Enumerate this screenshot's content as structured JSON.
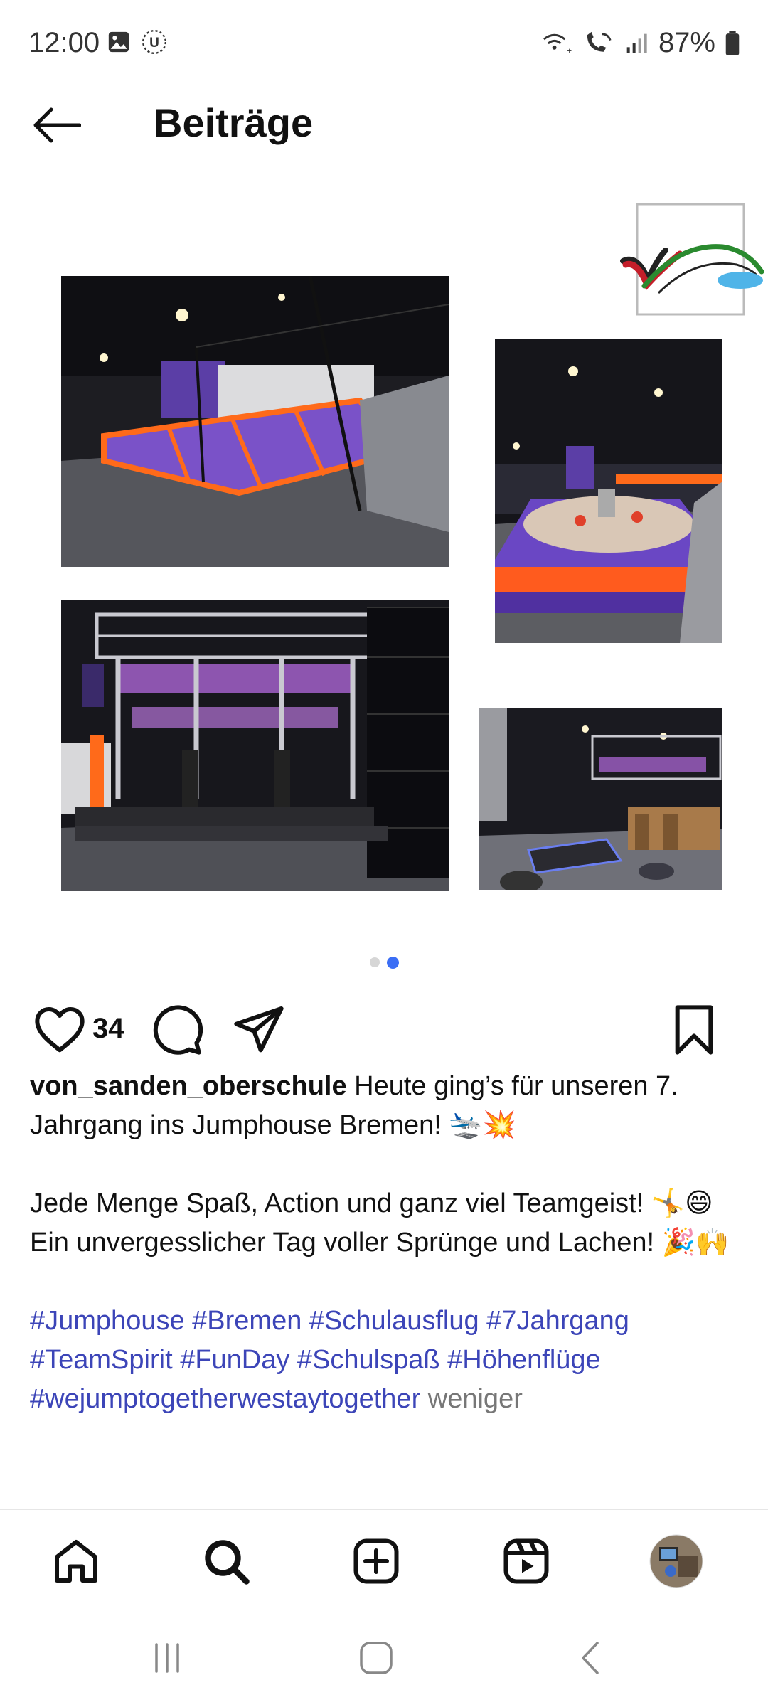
{
  "status": {
    "time": "12:00",
    "battery": "87%"
  },
  "header": {
    "title": "Beiträge"
  },
  "carousel": {
    "page_count": 2,
    "active_page": 2
  },
  "post": {
    "likes": "34",
    "username": "von_sanden_oberschule",
    "caption_line1": " Heute ging’s für unseren 7. Jahrgang ins Jumphouse Bremen! 🛬💥",
    "caption_line2": "Jede Menge Spaß, Action und ganz viel Teamgeist! 🤸😄",
    "caption_line3": "Ein unvergesslicher Tag voller Sprünge und Lachen! 🎉🙌",
    "hashtags": "#Jumphouse #Bremen #Schulausflug #7Jahrgang #TeamSpirit #FunDay #Schulspaß #Höhenflüge #wejumptogetherwestaytogether",
    "less_label": "weniger"
  },
  "colors": {
    "accent": "#3b6ef5",
    "hashtag": "#3c45b8"
  },
  "icons": {
    "back": "arrow-left-icon",
    "like": "heart-icon",
    "comment": "comment-icon",
    "share": "paper-plane-icon",
    "save": "bookmark-icon",
    "home": "home-icon",
    "search": "search-icon",
    "create": "plus-square-icon",
    "reels": "reels-icon",
    "profile": "avatar"
  }
}
